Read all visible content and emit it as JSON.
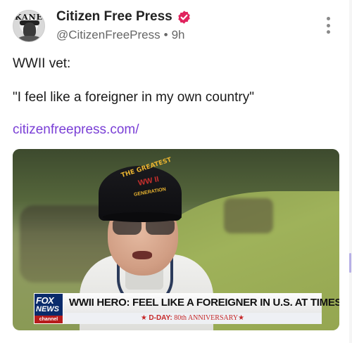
{
  "post": {
    "author": {
      "display_name": "Citizen Free Press",
      "handle": "@CitizenFreePress",
      "separator": "•",
      "time": "9h",
      "avatar_text": "KANE",
      "verified_icon": "verified-badge-icon",
      "verified_color": "#e0245e"
    },
    "more_icon": "more-vertical-icon",
    "body_lines": [
      "WWII vet:",
      "\"I feel like a foreigner in my own country\""
    ],
    "link_text": "citizenfreepress.com/",
    "link_color": "#7a3fd6",
    "media": {
      "cap_text_top": "THE GREATEST",
      "cap_text_mid": "WW II",
      "cap_text_bottom": "GENERATION",
      "chyron": {
        "logo_fox": "FOX",
        "logo_news": "NEWS",
        "logo_channel": "channel",
        "headline": "WWII HERO: FEEL LIKE A FOREIGNER IN U.S. AT TIMES",
        "sub_star_left": "★",
        "sub_prefix": "D-DAY:",
        "sub_text": "80th ANNIVERSARY",
        "sub_star_right": "★"
      }
    }
  }
}
